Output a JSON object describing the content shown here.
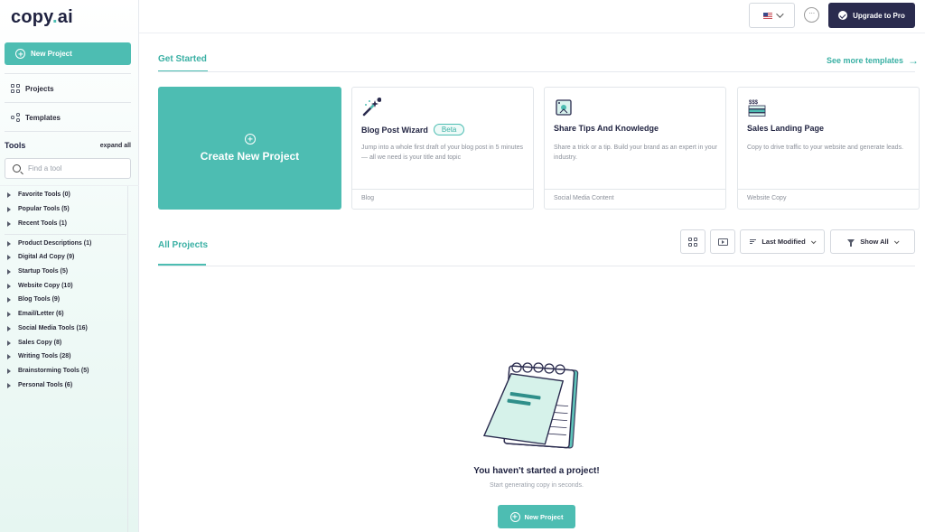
{
  "app": {
    "logo_main": "copy",
    "logo_dot": ".",
    "logo_ai": "ai"
  },
  "sidebar": {
    "new_project_label": "New Project",
    "nav": [
      {
        "label": "Projects",
        "icon": "grid-icon"
      },
      {
        "label": "Templates",
        "icon": "share-icon"
      }
    ],
    "tools_title": "Tools",
    "expand_all_label": "expand all",
    "search_placeholder": "Find a tool",
    "tool_groups_top": [
      "Favorite Tools (0)",
      "Popular Tools (5)",
      "Recent Tools (1)"
    ],
    "tool_groups": [
      "Product Descriptions (1)",
      "Digital Ad Copy (9)",
      "Startup Tools (5)",
      "Website Copy (10)",
      "Blog Tools (9)",
      "Email/Letter (6)",
      "Social Media Tools (16)",
      "Sales Copy (8)",
      "Writing Tools (28)",
      "Brainstorming Tools (5)",
      "Personal Tools (6)"
    ]
  },
  "header": {
    "language_flag": "us-flag-icon",
    "more_icon": "ellipsis-circle-icon",
    "upgrade_label": "Upgrade to Pro"
  },
  "get_started": {
    "tab_label": "Get Started",
    "see_more_label": "See more templates",
    "create_card_label": "Create New Project",
    "cards": [
      {
        "title": "Blog Post Wizard",
        "badge": "Beta",
        "description": "Jump into a whole first draft of your blog post in 5 minutes — all we need is your title and topic",
        "category": "Blog",
        "icon": "magic-wand-icon"
      },
      {
        "title": "Share Tips And Knowledge",
        "badge": "",
        "description": "Share a trick or a tip. Build your brand as an expert in your industry.",
        "category": "Social Media Content",
        "icon": "tips-icon"
      },
      {
        "title": "Sales Landing Page",
        "badge": "",
        "description": "Copy to drive traffic to your website and generate leads.",
        "category": "Website Copy",
        "icon": "landing-page-icon"
      }
    ]
  },
  "projects": {
    "tab_label": "All Projects",
    "sort_label": "Last Modified",
    "filter_label": "Show All",
    "empty_title": "You haven't started a project!",
    "empty_subtitle": "Start generating copy in seconds.",
    "empty_button_label": "New Project"
  },
  "colors": {
    "accent": "#4dbdb2",
    "accent_text": "#3ab0a4",
    "dark": "#2a2b4e"
  }
}
